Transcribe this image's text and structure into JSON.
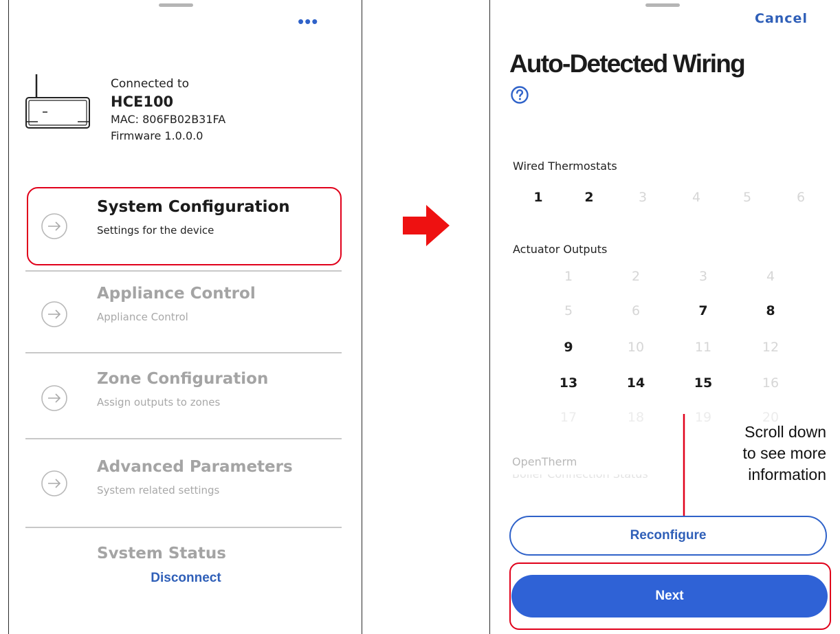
{
  "left_screen": {
    "more_menu": "•••",
    "connection": {
      "label": "Connected to",
      "device_name": "HCE100",
      "mac": "MAC: 806FB02B31FA",
      "firmware": "Firmware 1.0.0.0"
    },
    "menu": [
      {
        "title": "System Configuration",
        "subtitle": "Settings for the device",
        "state": "active"
      },
      {
        "title": "Appliance Control",
        "subtitle": "Appliance Control",
        "state": "disabled"
      },
      {
        "title": "Zone Configuration",
        "subtitle": "Assign outputs to zones",
        "state": "disabled"
      },
      {
        "title": "Advanced Parameters",
        "subtitle": "System related settings",
        "state": "disabled"
      },
      {
        "title": "System Status",
        "subtitle": "",
        "state": "disabled"
      }
    ],
    "disconnect_label": "Disconnect"
  },
  "right_screen": {
    "cancel_label": "Cancel",
    "title": "Auto-Detected Wiring",
    "wired_thermostats": {
      "label": "Wired Thermostats",
      "items": [
        {
          "n": "1",
          "detected": true
        },
        {
          "n": "2",
          "detected": true
        },
        {
          "n": "3",
          "detected": false
        },
        {
          "n": "4",
          "detected": false
        },
        {
          "n": "5",
          "detected": false
        },
        {
          "n": "6",
          "detected": false
        }
      ]
    },
    "actuator_outputs": {
      "label": "Actuator Outputs",
      "items": [
        {
          "n": "1",
          "detected": false
        },
        {
          "n": "2",
          "detected": false
        },
        {
          "n": "3",
          "detected": false
        },
        {
          "n": "4",
          "detected": false
        },
        {
          "n": "5",
          "detected": false
        },
        {
          "n": "6",
          "detected": false
        },
        {
          "n": "7",
          "detected": true
        },
        {
          "n": "8",
          "detected": true
        },
        {
          "n": "9",
          "detected": true
        },
        {
          "n": "10",
          "detected": false
        },
        {
          "n": "11",
          "detected": false
        },
        {
          "n": "12",
          "detected": false
        },
        {
          "n": "13",
          "detected": true
        },
        {
          "n": "14",
          "detected": true
        },
        {
          "n": "15",
          "detected": true
        },
        {
          "n": "16",
          "detected": false
        },
        {
          "n": "17",
          "detected": false
        },
        {
          "n": "18",
          "detected": false
        },
        {
          "n": "19",
          "detected": false
        },
        {
          "n": "20",
          "detected": false
        }
      ]
    },
    "opentherm_label": "OpenTherm",
    "opentherm_cutoff": "Boiler Connection Status",
    "reconfigure_label": "Reconfigure",
    "next_label": "Next"
  },
  "annotation": {
    "lines": [
      "Scroll down",
      "to see more",
      "information"
    ]
  },
  "colors": {
    "accent_blue": "#2f62d6",
    "highlight_red": "#e0001a",
    "arrow_red": "#ee1111"
  },
  "icons": [
    "more-dots-icon",
    "wifi-router-icon",
    "arrow-circle-icon",
    "help-circle-icon",
    "right-arrow-icon",
    "down-arrow-icon"
  ]
}
